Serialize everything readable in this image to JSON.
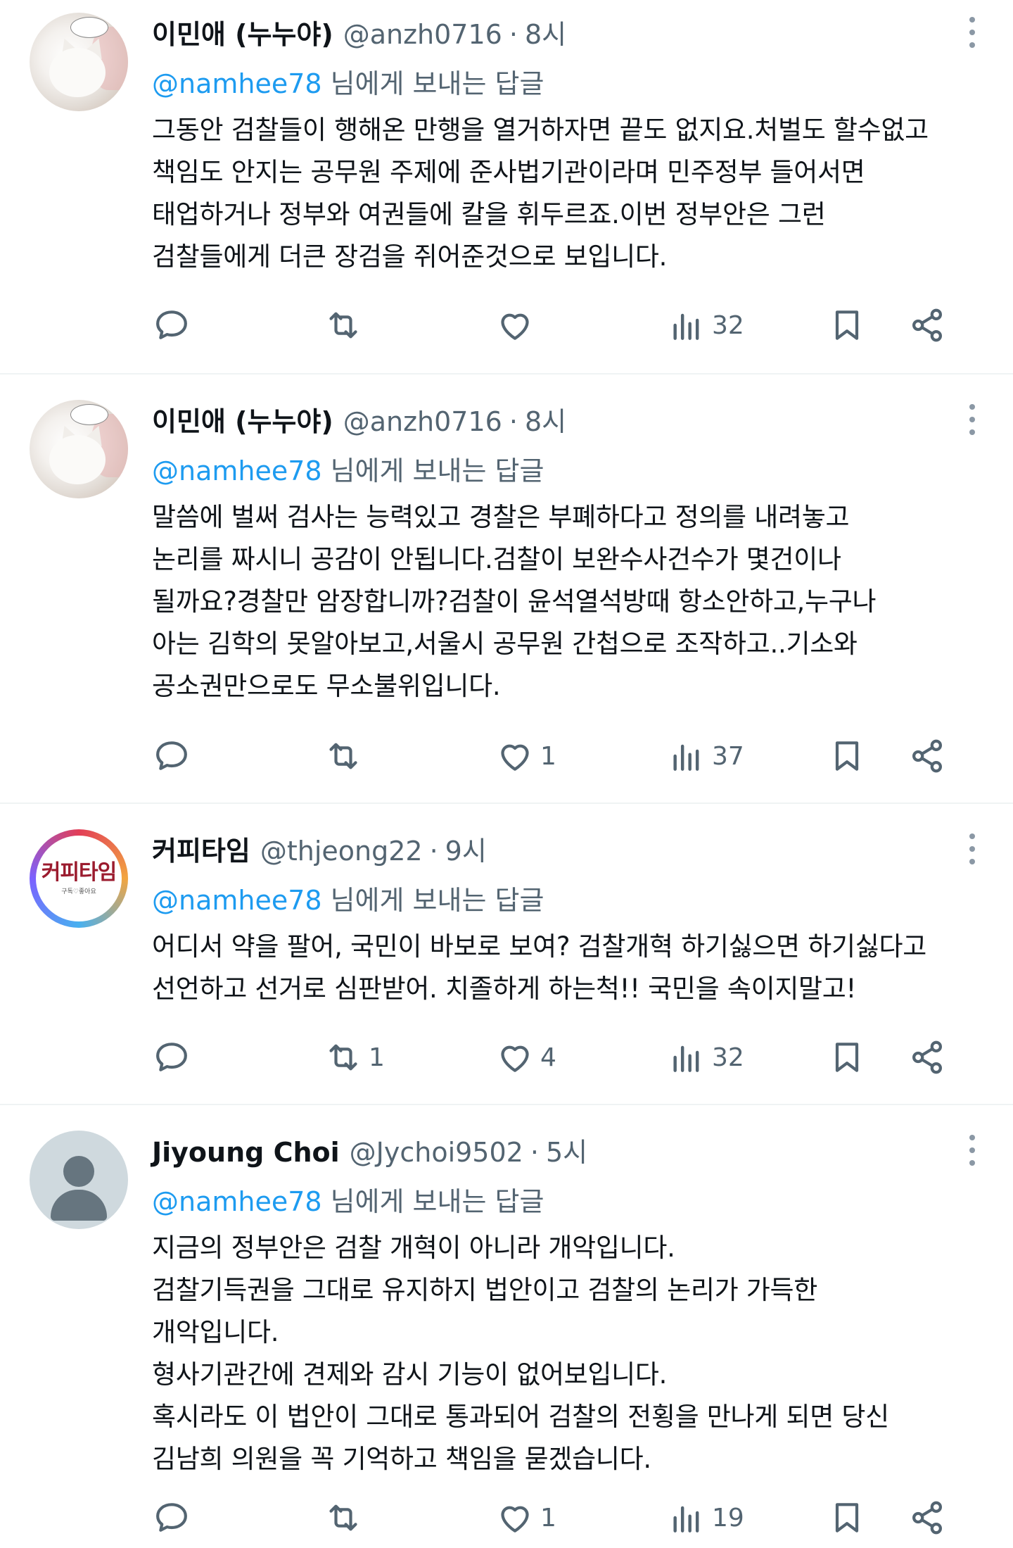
{
  "tweets": [
    {
      "display_name": "이민애 (누누야)",
      "handle": "@anzh0716",
      "time": "8시",
      "avatar": "cat-photo",
      "reply_mention": "@namhee78",
      "reply_suffix": "님에게 보내는 답글",
      "text": "그동안 검찰들이 행해온 만행을 열거하자면 끝도 없지요.처벌도 할수없고\n책임도 안지는 공무원 주제에 준사법기관이라며 민주정부 들어서면\n태업하거나 정부와 여권들에 칼을 휘두르죠.이번 정부안은 그런\n검찰들에게 더큰 장검을 쥐어준것으로 보입니다.",
      "retweets": "",
      "likes": "",
      "views": "32"
    },
    {
      "display_name": "이민애 (누누야)",
      "handle": "@anzh0716",
      "time": "8시",
      "avatar": "cat-photo",
      "reply_mention": "@namhee78",
      "reply_suffix": "님에게 보내는 답글",
      "text": "말씀에 벌써 검사는 능력있고 경찰은 부폐하다고 정의를 내려놓고\n논리를 짜시니 공감이 안됩니다.검찰이 보완수사건수가 몇건이나\n될까요?경찰만 암장합니까?검찰이 윤석열석방때 항소안하고,누구나\n아는 김학의 못알아보고,서울시 공무원 간첩으로 조작하고..기소와\n공소권만으로도 무소불위입니다.",
      "retweets": "",
      "likes": "1",
      "views": "37"
    },
    {
      "display_name": "커피타임",
      "handle": "@thjeong22",
      "time": "9시",
      "avatar": "coffee-logo",
      "avatar_logo_text": "커피타임",
      "avatar_logo_sub": "구독♡좋아요",
      "reply_mention": "@namhee78",
      "reply_suffix": "님에게 보내는 답글",
      "text": "어디서 약을 팔어, 국민이 바보로 보여? 검찰개혁 하기싫으면 하기싫다고\n선언하고 선거로 심판받어. 치졸하게 하는척!! 국민을 속이지말고!",
      "retweets": "1",
      "likes": "4",
      "views": "32"
    },
    {
      "display_name": "Jiyoung Choi",
      "handle": "@Jychoi9502",
      "time": "5시",
      "avatar": "default-person",
      "reply_mention": "@namhee78",
      "reply_suffix": "님에게 보내는 답글",
      "text": "지금의 정부안은 검찰 개혁이 아니라 개악입니다.\n검찰기득권을 그대로 유지하지 법안이고 검찰의 논리가 가득한\n개악입니다.\n형사기관간에 견제와 감시 기능이 없어보입니다.\n혹시라도 이 법안이 그대로 통과되어 검찰의 전횡을 만나게 되면 당신\n김남희 의원을 꼭 기억하고 책임을 묻겠습니다.",
      "retweets": "",
      "likes": "1",
      "views": "19"
    }
  ],
  "icons": {
    "reply": "speech-bubble-icon",
    "retweet": "retweet-arrows-icon",
    "like": "heart-icon",
    "views": "bar-chart-icon",
    "bookmark": "bookmark-icon",
    "share": "share-icon",
    "more": "vertical-dots-icon"
  },
  "colors": {
    "mention": "#1d9bf0",
    "secondary_text": "#536471",
    "primary_text": "#0f1419",
    "divider": "#eff3f4"
  },
  "separator": "·"
}
